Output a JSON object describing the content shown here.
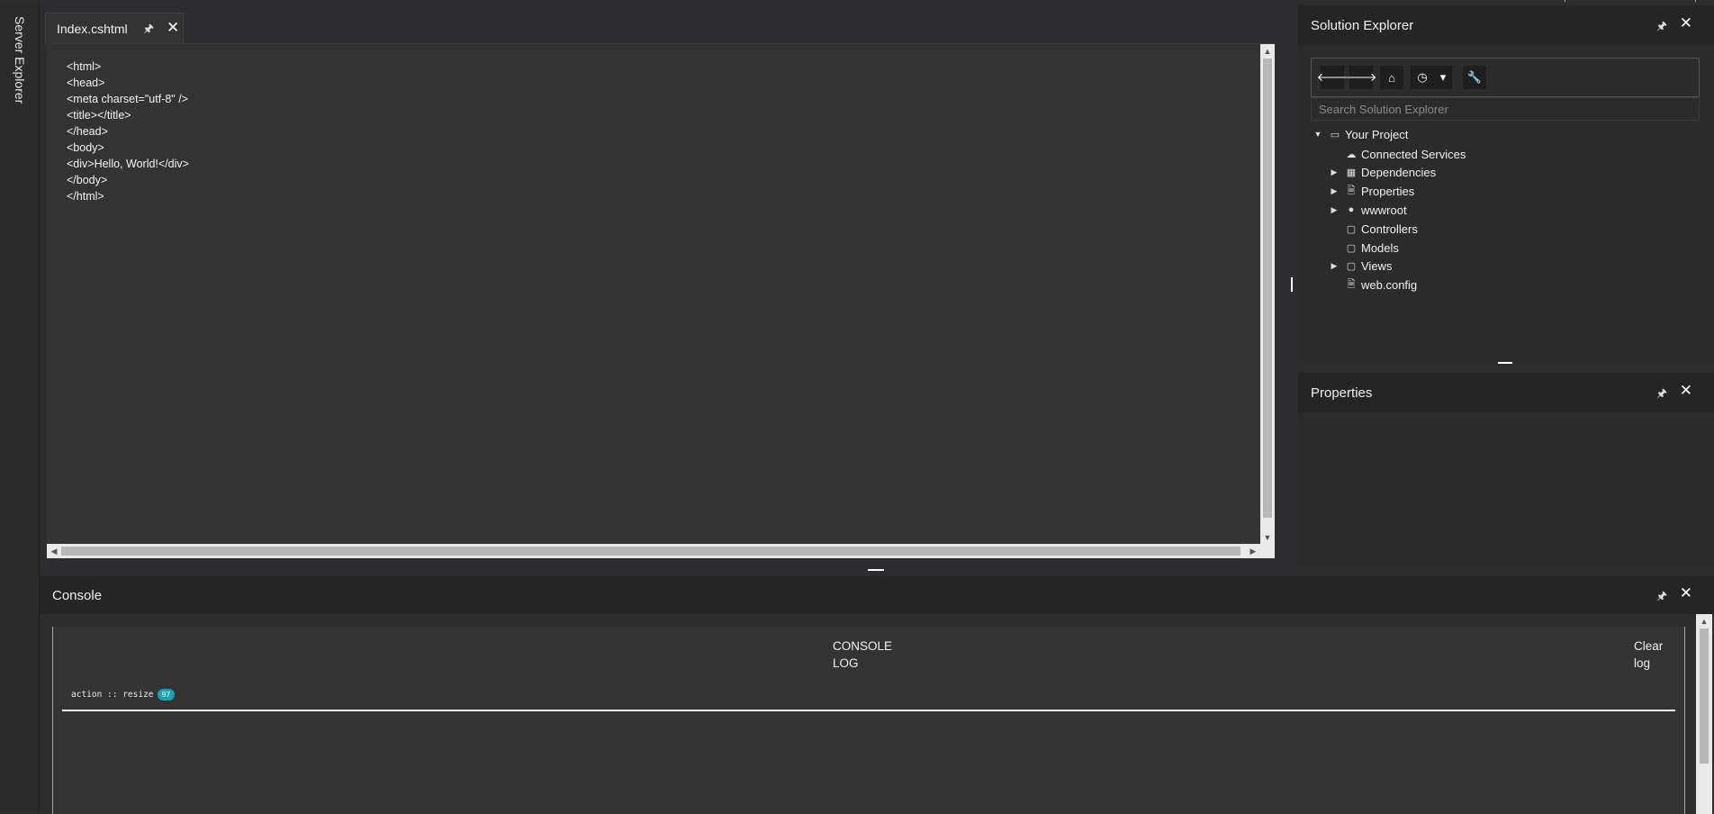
{
  "left_strip": {
    "tab_label": "Server Explorer"
  },
  "editor": {
    "tab": {
      "label": "Index.cshtml",
      "pin": "🖈",
      "close": "✕"
    },
    "code_lines": [
      "<html>",
      "<head>",
      "<meta charset=\"utf-8\" />",
      "<title></title>",
      "</head>",
      "<body>",
      "<div>Hello, World!</div>",
      "</body>",
      "</html>"
    ]
  },
  "solution_explorer": {
    "title": "Solution Explorer",
    "search_placeholder": "Search Solution Explorer",
    "toolbar": {
      "back": "🡐",
      "forward": "🡒",
      "home": "⌂",
      "history": "◷",
      "dropdown": "▾",
      "wrench": "🔧"
    },
    "tree": [
      {
        "label": "Your Project",
        "icon": "project-icon",
        "expand": "▼"
      },
      {
        "label": "Connected Services",
        "icon": "cloud-icon",
        "expand": ""
      },
      {
        "label": "Dependencies",
        "icon": "dependencies-icon",
        "expand": "▶"
      },
      {
        "label": "Properties",
        "icon": "properties-icon",
        "expand": "▶"
      },
      {
        "label": "wwwroot",
        "icon": "globe-icon",
        "expand": "▶"
      },
      {
        "label": "Controllers",
        "icon": "folder-icon",
        "expand": ""
      },
      {
        "label": "Models",
        "icon": "folder-icon",
        "expand": ""
      },
      {
        "label": "Views",
        "icon": "folder-icon",
        "expand": "▶"
      },
      {
        "label": "web.config",
        "icon": "config-file-icon",
        "expand": ""
      }
    ]
  },
  "properties_panel": {
    "title": "Properties"
  },
  "console": {
    "title": "Console",
    "heading": "CONSOLE LOG",
    "clear_button": "Clear log",
    "log": {
      "text": "action :: resize",
      "count": "97"
    }
  },
  "colors": {
    "background": "#2d2d30",
    "panel": "#2b2b2b",
    "header": "#252526",
    "badge": "#17a2b8"
  }
}
